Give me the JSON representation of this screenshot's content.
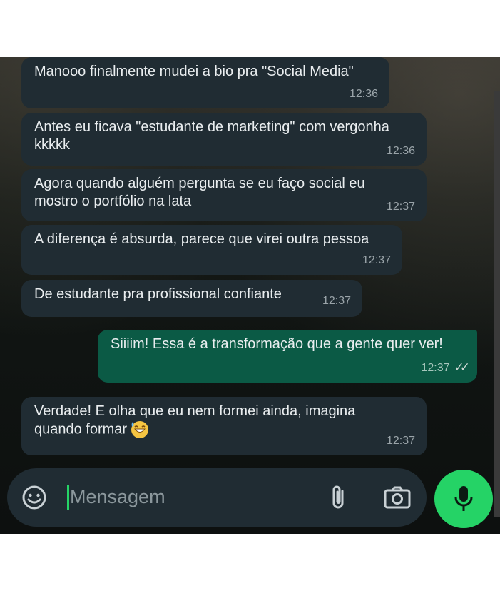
{
  "messages": [
    {
      "direction": "in",
      "text": "Manooo finalmente mudei a bio pra \"Social Media\"",
      "time": "12:36"
    },
    {
      "direction": "in",
      "text": "Antes eu ficava \"estudante de marketing\" com vergonha\nkkkkk",
      "time": "12:36"
    },
    {
      "direction": "in",
      "text": "Agora quando alguém pergunta se eu faço social eu\nmostro o portfólio na lata",
      "time": "12:37"
    },
    {
      "direction": "in",
      "text": "A diferença é absurda, parece que virei outra pessoa",
      "time": "12:37"
    },
    {
      "direction": "in",
      "text": "De estudante pra profissional confiante",
      "time": "12:37"
    },
    {
      "direction": "out",
      "text": "Siiiim! Essa é a transformação que a gente quer ver!",
      "time": "12:37",
      "status": "read"
    },
    {
      "direction": "in",
      "text": "Verdade! E olha que eu nem formei ainda, imagina\nquando formar",
      "time": "12:37",
      "emoji": "grinning-sweat-emoji"
    }
  ],
  "composer": {
    "placeholder": "Mensagem",
    "icons": [
      "sticker-icon",
      "attach-icon",
      "camera-icon",
      "mic-icon"
    ]
  },
  "colors": {
    "incoming_bubble": "#202c33",
    "outgoing_bubble": "#0b5a45",
    "accent": "#25d366"
  }
}
